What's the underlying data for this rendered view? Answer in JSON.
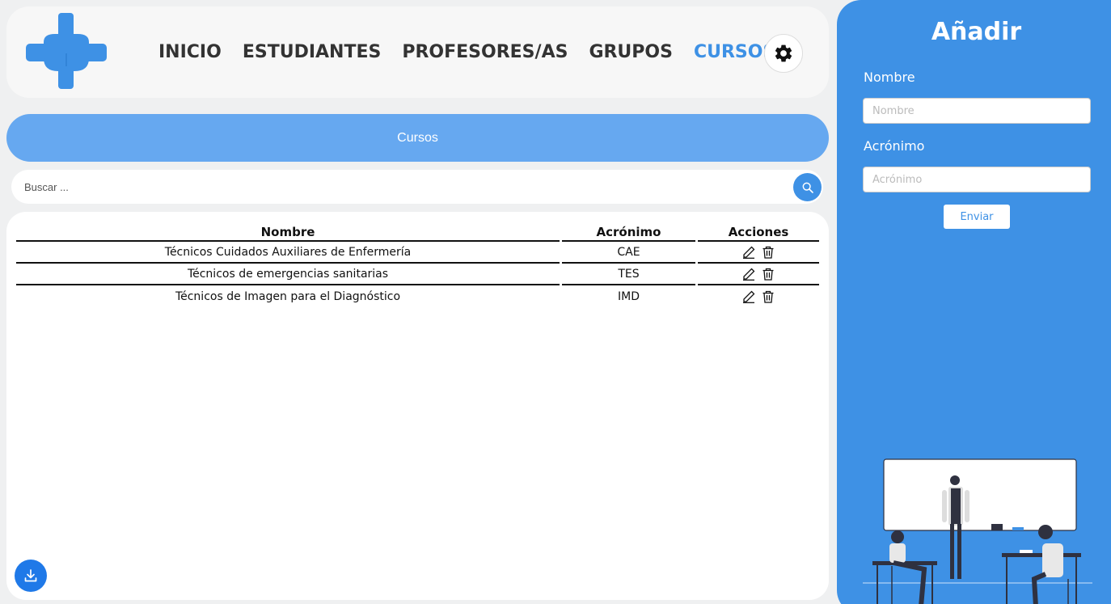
{
  "nav": {
    "items": [
      {
        "label": "INICIO",
        "active": false
      },
      {
        "label": "ESTUDIANTES",
        "active": false
      },
      {
        "label": "PROFESORES/AS",
        "active": false
      },
      {
        "label": "GRUPOS",
        "active": false
      },
      {
        "label": "CURSOS",
        "active": true
      }
    ]
  },
  "banner": {
    "title": "Cursos"
  },
  "search": {
    "placeholder": "Buscar ..."
  },
  "table": {
    "headers": {
      "name": "Nombre",
      "acronym": "Acrónimo",
      "actions": "Acciones"
    },
    "rows": [
      {
        "name": "Técnicos Cuidados Auxiliares de Enfermería",
        "acronym": "CAE"
      },
      {
        "name": "Técnicos de emergencias sanitarias",
        "acronym": "TES"
      },
      {
        "name": "Técnicos de Imagen para el Diagnóstico",
        "acronym": "IMD"
      }
    ]
  },
  "sidebar": {
    "title": "Añadir",
    "name_label": "Nombre",
    "name_placeholder": "Nombre",
    "acronym_label": "Acrónimo",
    "acronym_placeholder": "Acrónimo",
    "submit_label": "Enviar"
  },
  "colors": {
    "accent": "#3e91e5",
    "banner": "#66a8f0",
    "download": "#1f79e8"
  },
  "icons": [
    "medical-cross-logo",
    "gear-icon",
    "search-icon",
    "pencil-icon",
    "trash-icon",
    "download-icon"
  ]
}
